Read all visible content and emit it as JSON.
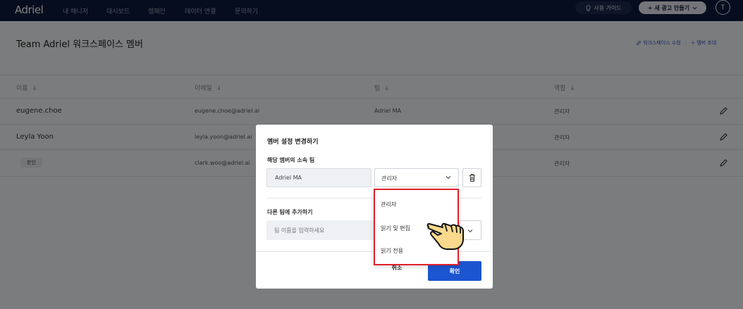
{
  "nav": {
    "logo": "Adriel",
    "links": [
      "내 매니저",
      "대시보드",
      "캠페인",
      "데이터 연결",
      "문의하기"
    ],
    "guide_button": "사용 가이드",
    "new_ad_button": "+ 새 광고 만들기",
    "avatar_initial": "T"
  },
  "page": {
    "title": "Team Adriel 워크스페이스 멤버",
    "edit_workspace": "워크스페이스 수정",
    "invite_member": "+ 멤버 초대"
  },
  "table": {
    "headers": [
      "이름",
      "이메일",
      "팀",
      "역할"
    ],
    "rows": [
      {
        "name": "eugene.choe",
        "email": "eugene.choe@adriel.ai",
        "team": "Adriel MA",
        "role": "관리자"
      },
      {
        "name": "Leyla Yoon",
        "email": "leyla.yoon@adriel.ai",
        "team": "",
        "role": "관리자"
      },
      {
        "name": "본인",
        "email": "clark.woo@adriel.ai",
        "team": "",
        "role": "관리자"
      }
    ]
  },
  "modal": {
    "title": "멤버 설정 변경하기",
    "team_section_label": "해당 멤버의 소속 팀",
    "team_value": "Adriel MA",
    "role_value": "관리자",
    "add_team_label": "다른 팀에 추가하기",
    "team_input_placeholder": "팀 이름을 입력하세요",
    "cancel": "취소",
    "confirm": "확인"
  },
  "role_dropdown": {
    "options": [
      "관리자",
      "읽기 및 편집",
      "읽기 전용"
    ]
  },
  "colors": {
    "nav_bg": "#0d1b3d",
    "primary": "#1b55d0",
    "highlight": "#e2202b"
  }
}
